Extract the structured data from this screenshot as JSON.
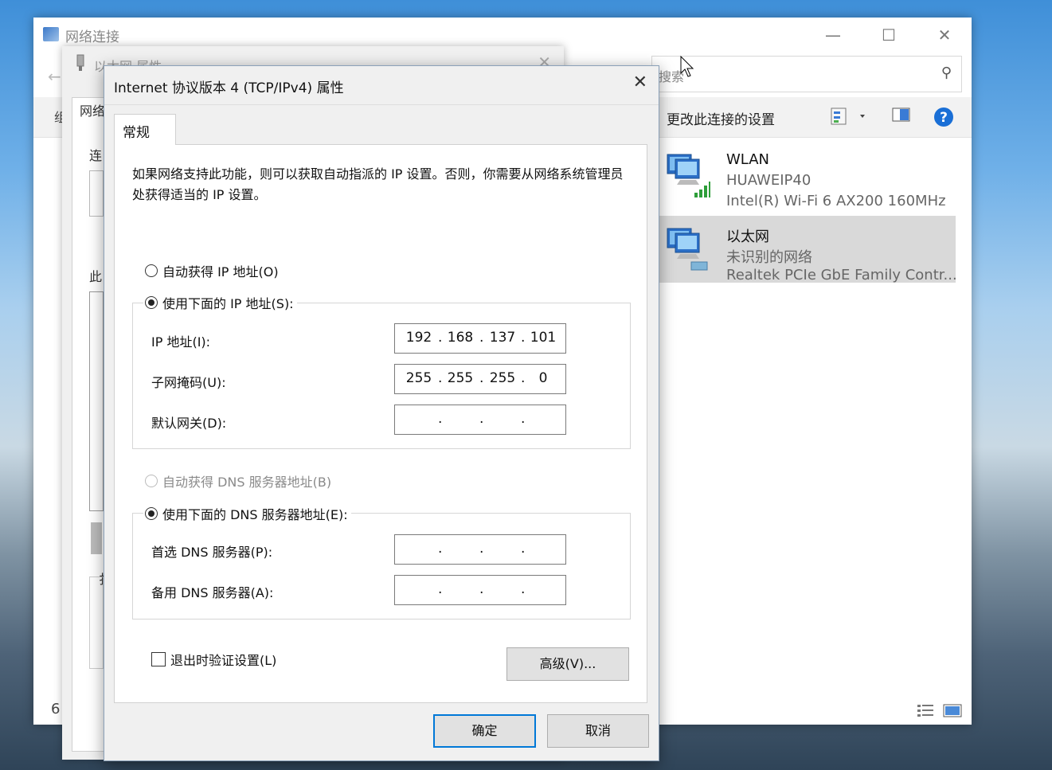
{
  "bg_window": {
    "title": "网络连接",
    "search_placeholder": "搜索",
    "change_settings": "更改此连接的设置",
    "left_fragments": [
      "组",
      "6"
    ],
    "connections": [
      {
        "name": "WLAN",
        "network": "HUAWEIP40",
        "adapter": "Intel(R) Wi-Fi 6 AX200 160MHz"
      },
      {
        "name": "以太网",
        "network": "未识别的网络",
        "adapter": "Realtek PCIe GbE Family Contr..."
      }
    ]
  },
  "mid_window": {
    "title": "以太网 属性",
    "fragments": [
      "网络",
      "连",
      "此",
      "扌"
    ]
  },
  "dialog": {
    "title": "Internet 协议版本 4 (TCP/IPv4) 属性",
    "tab": "常规",
    "description": "如果网络支持此功能，则可以获取自动指派的 IP 设置。否则，你需要从网络系统管理员处获得适当的 IP 设置。",
    "ip_auto": "自动获得 IP 地址(O)",
    "ip_manual": "使用下面的 IP 地址(S):",
    "ip_label": "IP 地址(I):",
    "subnet_label": "子网掩码(U):",
    "gateway_label": "默认网关(D):",
    "ip": [
      "192",
      "168",
      "137",
      "101"
    ],
    "subnet": [
      "255",
      "255",
      "255",
      "0"
    ],
    "dns_auto": "自动获得 DNS 服务器地址(B)",
    "dns_manual": "使用下面的 DNS 服务器地址(E):",
    "dns_pref_label": "首选 DNS 服务器(P):",
    "dns_alt_label": "备用 DNS 服务器(A):",
    "validate": "退出时验证设置(L)",
    "advanced": "高级(V)...",
    "ok": "确定",
    "cancel": "取消"
  }
}
